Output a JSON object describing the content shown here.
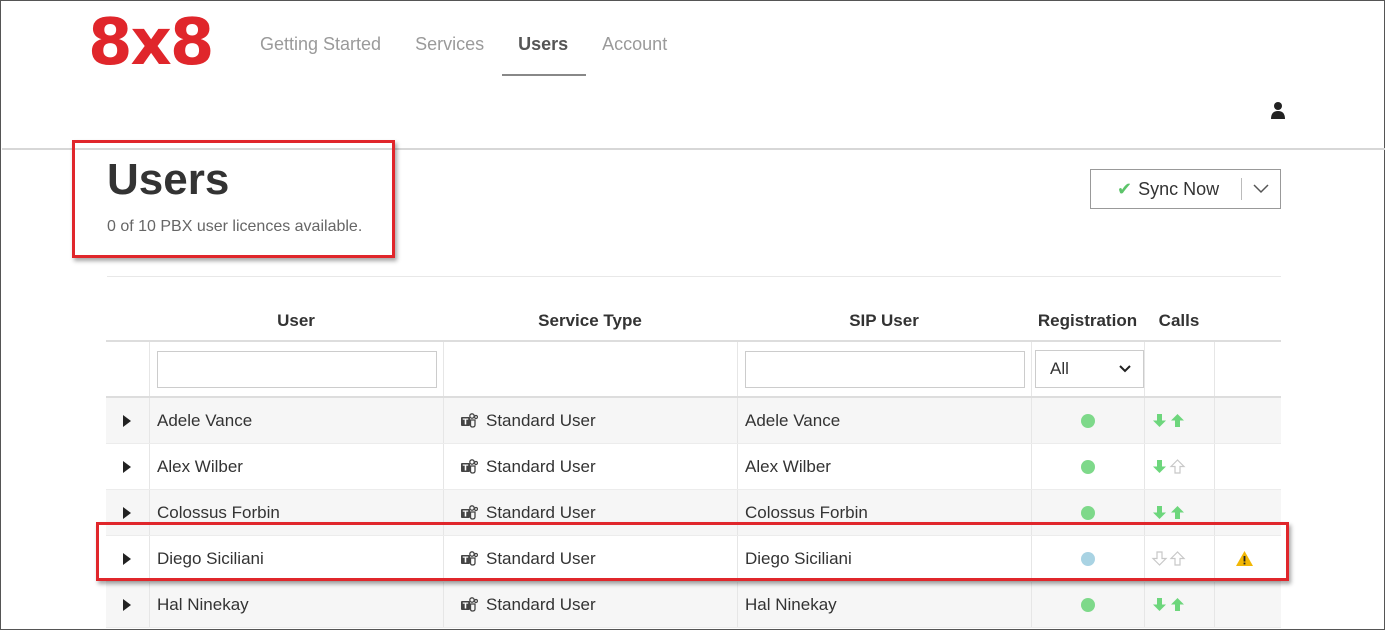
{
  "logo": {
    "text": "8x8",
    "color": "#e0262b"
  },
  "nav": [
    {
      "label": "Getting Started",
      "active": false
    },
    {
      "label": "Services",
      "active": false
    },
    {
      "label": "Users",
      "active": true
    },
    {
      "label": "Account",
      "active": false
    }
  ],
  "page": {
    "title": "Users",
    "subtitle": "0 of 10 PBX user licences available."
  },
  "sync_button": {
    "label": "Sync Now",
    "check_icon": "check-icon",
    "dropdown_icon": "chevron-down-icon"
  },
  "table": {
    "headers": [
      "",
      "User",
      "Service Type",
      "SIP User",
      "Registration",
      "Calls",
      ""
    ],
    "filters": {
      "user": "",
      "sip_user": "",
      "registration": "All"
    },
    "rows": [
      {
        "user": "Adele Vance",
        "service_type": "Standard User",
        "sip_user": "Adele Vance",
        "registration": "registered",
        "incoming": true,
        "outgoing": true,
        "warning": false
      },
      {
        "user": "Alex Wilber",
        "service_type": "Standard User",
        "sip_user": "Alex Wilber",
        "registration": "registered",
        "incoming": true,
        "outgoing": false,
        "warning": false
      },
      {
        "user": "Colossus Forbin",
        "service_type": "Standard User",
        "sip_user": "Colossus Forbin",
        "registration": "registered",
        "incoming": true,
        "outgoing": true,
        "warning": false
      },
      {
        "user": "Diego Siciliani",
        "service_type": "Standard User",
        "sip_user": "Diego Siciliani",
        "registration": "unregistered",
        "incoming": false,
        "outgoing": false,
        "warning": true
      },
      {
        "user": "Hal Ninekay",
        "service_type": "Standard User",
        "sip_user": "Hal Ninekay",
        "registration": "registered",
        "incoming": true,
        "outgoing": true,
        "warning": false
      }
    ]
  },
  "colors": {
    "accent_red": "#e0262b",
    "registered": "#7ed98a",
    "unregistered": "#a9d3e3",
    "call_active": "#6dd67c",
    "call_inactive": "#c8c8c8",
    "warning": "#f2b705"
  }
}
